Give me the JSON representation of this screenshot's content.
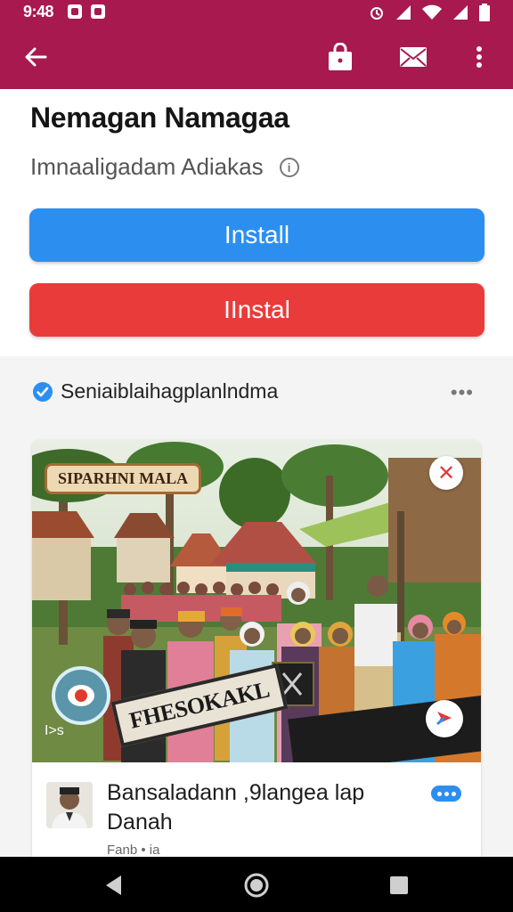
{
  "status_bar": {
    "time": "9:48"
  },
  "app_bar": {
    "back_icon": "arrow-left-icon",
    "actions": [
      "shopping-bag-icon",
      "mail-icon",
      "more-vert-icon"
    ]
  },
  "header": {
    "title": "Nemagan Namagaa",
    "subtitle": "Imnaaligadam Adiakas",
    "install_primary": "Install",
    "install_secondary": "IInstal"
  },
  "feed": {
    "account_name": "Seniaiblaihagplanlndma",
    "post": {
      "sign_top": "SIPARHNI MALA",
      "sign_board": "FHESOKAKL",
      "photo_caption": "I>s",
      "title": "Bansaladann ,9langea lap Danah",
      "meta": "Fanb  •  ia"
    }
  },
  "colors": {
    "primary": "#a7194f",
    "install_blue": "#2c8ff0",
    "install_red": "#ea3b3b"
  }
}
